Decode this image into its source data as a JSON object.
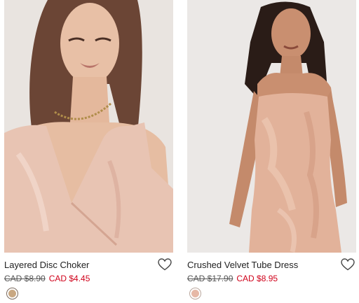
{
  "products": [
    {
      "name": "Layered Disc Choker",
      "price_original": "CAD $8.90",
      "price_sale": "CAD $4.45",
      "swatch_color": "#c9a882",
      "image": "woman-in-blush-satin-top-wearing-layered-disc-choker"
    },
    {
      "name": "Crushed Velvet Tube Dress",
      "price_original": "CAD $17.90",
      "price_sale": "CAD $8.95",
      "swatch_color": "#e6b8a6",
      "image": "woman-in-blush-crushed-velvet-tube-dress"
    }
  ],
  "colors": {
    "sale_price": "#d0021b",
    "text": "#222222",
    "photo_bg": "#ece7e4"
  },
  "icons": {
    "wishlist": "heart-outline-icon"
  }
}
